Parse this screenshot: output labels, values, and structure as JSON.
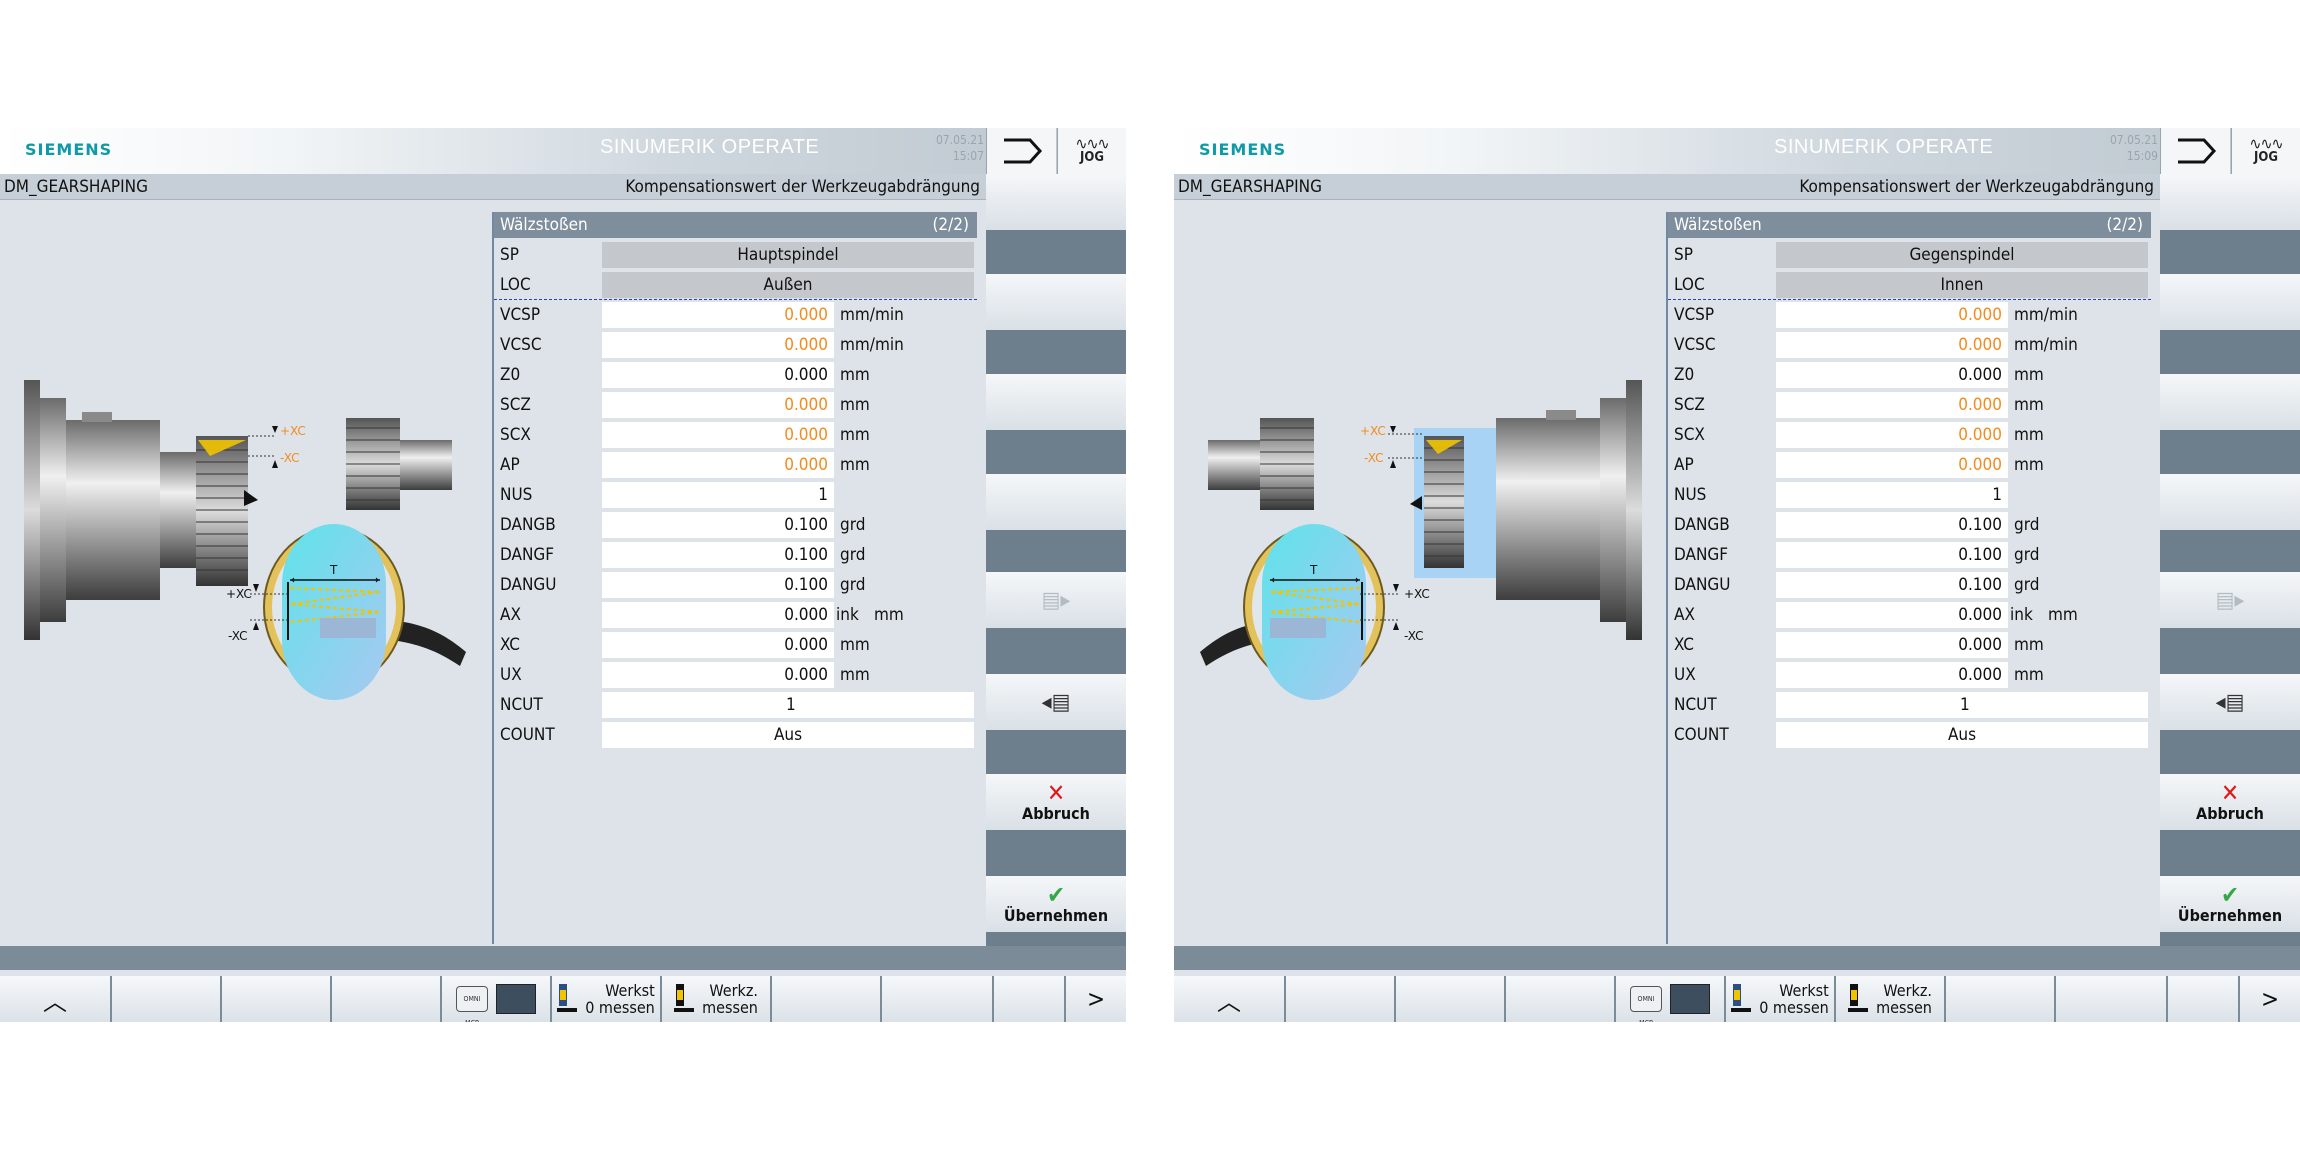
{
  "screens": [
    {
      "brand": "SIEMENS",
      "product": "SINUMERIK OPERATE",
      "date": "07.05.21",
      "time": "15:07",
      "mode": "JOG",
      "program": "DM_GEARSHAPING",
      "dialog_title": "Kompensationswert der Werkzeugabdrängung",
      "panel_title": "Wälzstoßen",
      "panel_page": "(2/2)",
      "sp_label": "SP",
      "sp_value": "Hauptspindel",
      "loc_label": "LOC",
      "loc_value": "Außen",
      "params": [
        {
          "label": "VCSP",
          "value": "0.000",
          "unit": "mm/min"
        },
        {
          "label": "VCSC",
          "value": "0.000",
          "unit": "mm/min"
        },
        {
          "label": "Z0",
          "value": "0.000",
          "unit": "mm"
        },
        {
          "label": "SCZ",
          "value": "0.000",
          "unit": "mm"
        },
        {
          "label": "SCX",
          "value": "0.000",
          "unit": "mm"
        },
        {
          "label": "AP",
          "value": "0.000",
          "unit": "mm"
        },
        {
          "label": "NUS",
          "value": "1",
          "unit": ""
        },
        {
          "label": "DANGB",
          "value": "0.100",
          "unit": "grd"
        },
        {
          "label": "DANGF",
          "value": "0.100",
          "unit": "grd"
        },
        {
          "label": "DANGU",
          "value": "0.100",
          "unit": "grd"
        },
        {
          "label": "AX",
          "value": "0.000",
          "ink": "ink",
          "unit": "mm"
        },
        {
          "label": "XC",
          "value": "0.000",
          "unit": "mm"
        },
        {
          "label": "UX",
          "value": "0.000",
          "unit": "mm"
        }
      ],
      "ncut_label": "NCUT",
      "ncut_value": "1",
      "count_label": "COUNT",
      "count_value": "Aus",
      "graphic": {
        "xc_plus": "+XC",
        "xc_minus": "-XC",
        "t_label": "T"
      },
      "softkeys": {
        "cancel": "Abbruch",
        "accept": "Übernehmen"
      },
      "hsoftkeys": {
        "mini_label": "OMNI MCP",
        "werkst_line1": "Werkst",
        "werkst_line2": "0 messen",
        "werkz_line1": "Werkz.",
        "werkz_line2": "messen"
      }
    },
    {
      "brand": "SIEMENS",
      "product": "SINUMERIK OPERATE",
      "date": "07.05.21",
      "time": "15:09",
      "mode": "JOG",
      "program": "DM_GEARSHAPING",
      "dialog_title": "Kompensationswert der Werkzeugabdrängung",
      "panel_title": "Wälzstoßen",
      "panel_page": "(2/2)",
      "sp_label": "SP",
      "sp_value": "Gegenspindel",
      "loc_label": "LOC",
      "loc_value": "Innen",
      "params": [
        {
          "label": "VCSP",
          "value": "0.000",
          "unit": "mm/min"
        },
        {
          "label": "VCSC",
          "value": "0.000",
          "unit": "mm/min"
        },
        {
          "label": "Z0",
          "value": "0.000",
          "unit": "mm"
        },
        {
          "label": "SCZ",
          "value": "0.000",
          "unit": "mm"
        },
        {
          "label": "SCX",
          "value": "0.000",
          "unit": "mm"
        },
        {
          "label": "AP",
          "value": "0.000",
          "unit": "mm"
        },
        {
          "label": "NUS",
          "value": "1",
          "unit": ""
        },
        {
          "label": "DANGB",
          "value": "0.100",
          "unit": "grd"
        },
        {
          "label": "DANGF",
          "value": "0.100",
          "unit": "grd"
        },
        {
          "label": "DANGU",
          "value": "0.100",
          "unit": "grd"
        },
        {
          "label": "AX",
          "value": "0.000",
          "ink": "ink",
          "unit": "mm"
        },
        {
          "label": "XC",
          "value": "0.000",
          "unit": "mm"
        },
        {
          "label": "UX",
          "value": "0.000",
          "unit": "mm"
        }
      ],
      "ncut_label": "NCUT",
      "ncut_value": "1",
      "count_label": "COUNT",
      "count_value": "Aus",
      "graphic": {
        "xc_plus": "+XC",
        "xc_minus": "-XC",
        "t_label": "T"
      },
      "softkeys": {
        "cancel": "Abbruch",
        "accept": "Übernehmen"
      },
      "hsoftkeys": {
        "mini_label": "OMNI MCP",
        "werkst_line1": "Werkst",
        "werkst_line2": "0 messen",
        "werkz_line1": "Werkz.",
        "werkz_line2": "messen"
      }
    }
  ],
  "colors": {
    "accent_orange": "#f28c1f",
    "siemens_teal": "#0f9aa8",
    "cancel_red": "#e01818",
    "ok_green": "#35a845",
    "title_bar": "#7e8e9c"
  }
}
